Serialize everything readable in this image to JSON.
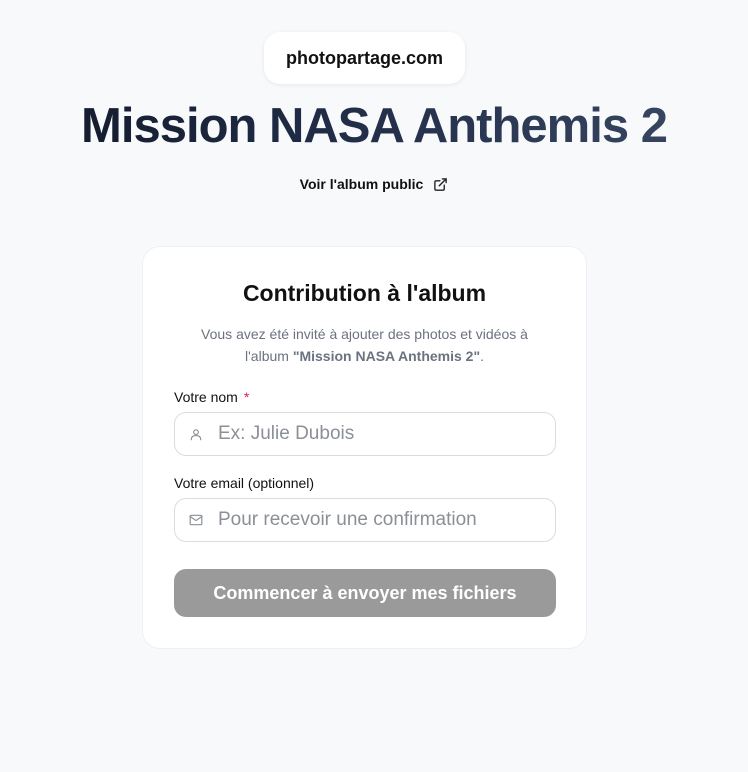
{
  "header": {
    "brand": "photopartage.com",
    "album_title": "Mission NASA Anthemis 2",
    "public_link_label": "Voir l'album public"
  },
  "card": {
    "title": "Contribution à l'album",
    "description_prefix": "Vous avez été invité à ajouter des photos et vidéos à l'album ",
    "description_album": "\"Mission NASA Anthemis 2\"",
    "description_suffix": ".",
    "name_field": {
      "label": "Votre nom",
      "required_mark": "*",
      "placeholder": "Ex: Julie Dubois",
      "value": ""
    },
    "email_field": {
      "label": "Votre email (optionnel)",
      "placeholder": "Pour recevoir une confirmation",
      "value": ""
    },
    "submit_label": "Commencer à envoyer mes fichiers"
  },
  "icons": {
    "public_link": "external-link-icon",
    "name": "user-icon",
    "email": "mail-icon"
  },
  "colors": {
    "background": "#f8f9fb",
    "title_dark": "#111827",
    "title_light": "#3b4a66",
    "required": "#e11d48",
    "button_disabled": "#9a9a9a"
  }
}
